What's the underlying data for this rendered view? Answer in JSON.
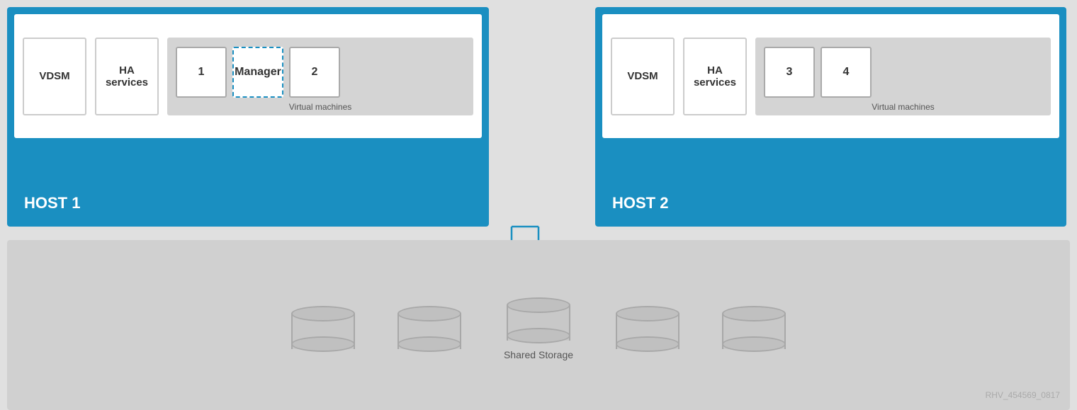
{
  "host1": {
    "label": "HOST 1",
    "vdsm": "VDSM",
    "ha_services": "HA\nservices",
    "vm_label": "Virtual machines",
    "vms": [
      "1",
      "Manager",
      "2"
    ]
  },
  "host2": {
    "label": "HOST 2",
    "vdsm": "VDSM",
    "ha_services": "HA\nservices",
    "vm_label": "Virtual machines",
    "vms": [
      "3",
      "4"
    ]
  },
  "storage": {
    "label": "Shared Storage",
    "disk_count": 5,
    "center_disk_index": 2
  },
  "watermark": "RHV_454569_0817",
  "colors": {
    "blue": "#1a8fc1",
    "light_gray": "#d4d4d4",
    "dark_gray": "#c0c0c0"
  }
}
